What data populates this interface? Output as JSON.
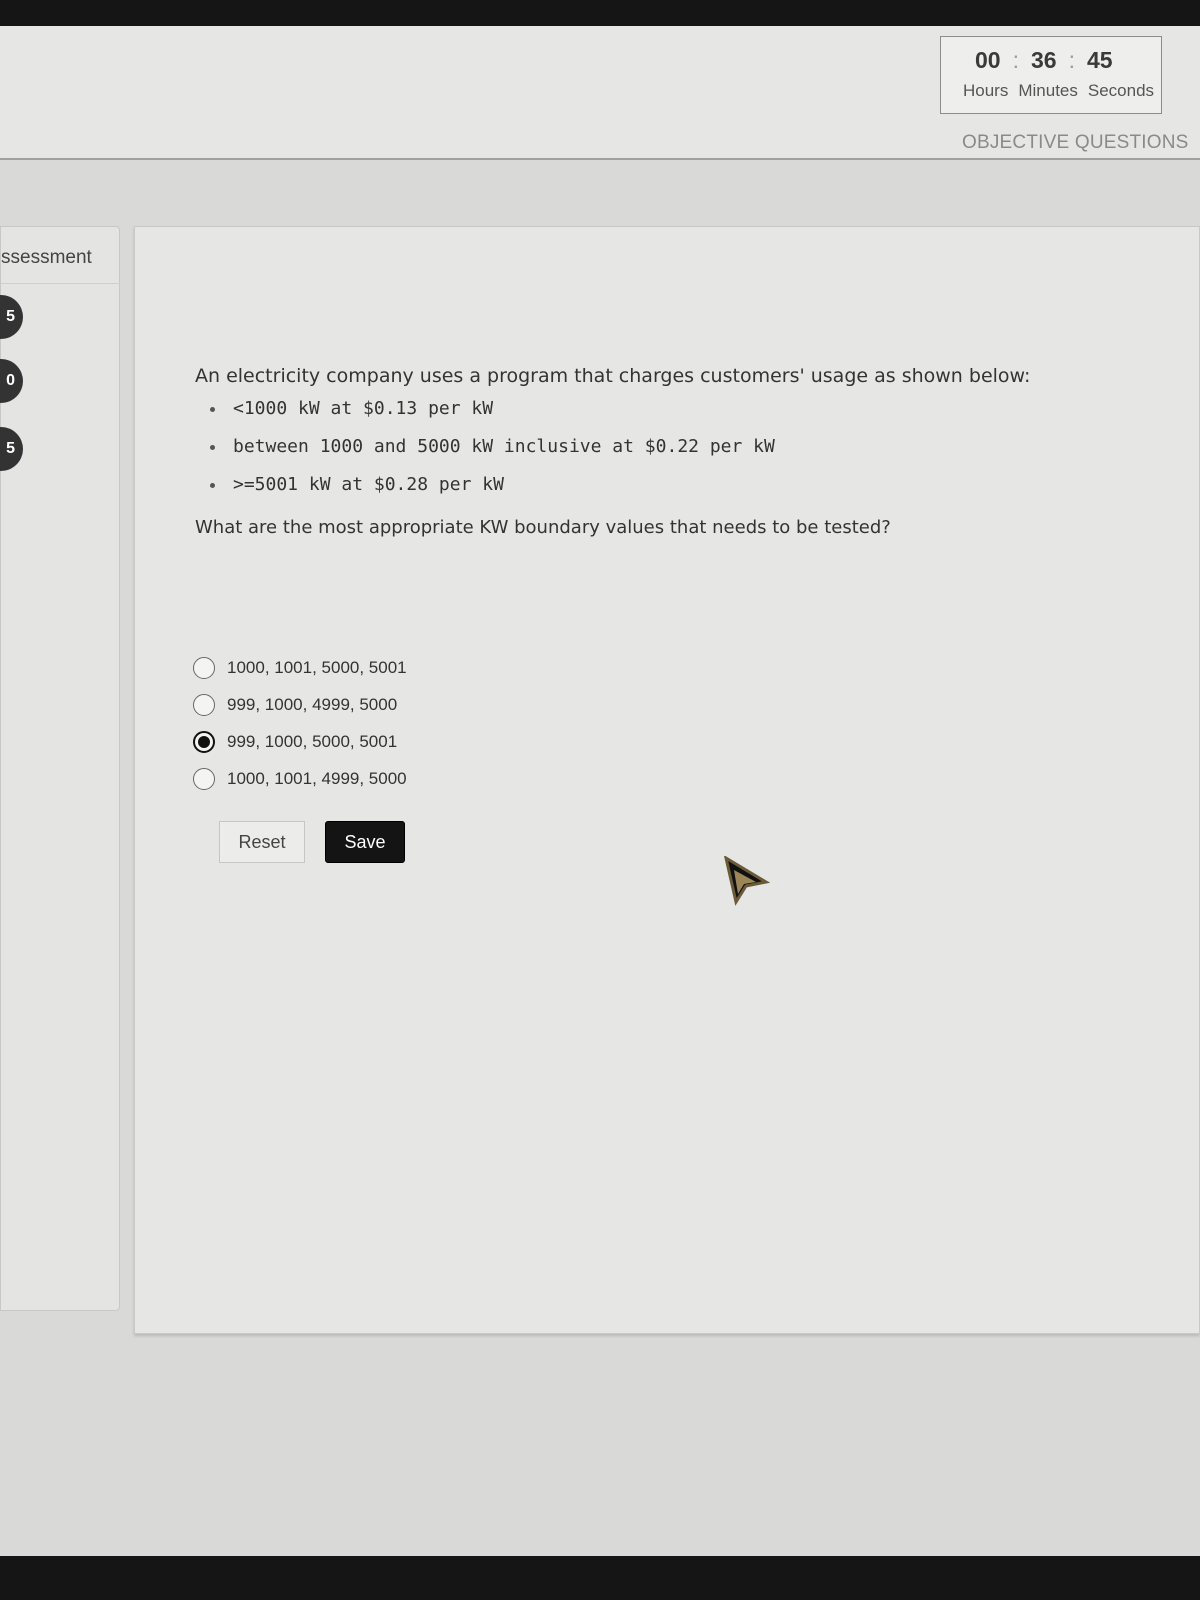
{
  "timer": {
    "hours": "00",
    "minutes": "36",
    "seconds": "45",
    "separator": ":",
    "hours_label": "Hours",
    "minutes_label": "Minutes",
    "seconds_label": "Seconds"
  },
  "header": {
    "section_tab": "OBJECTIVE QUESTIONS"
  },
  "sidebar": {
    "title": "ssessment",
    "question_numbers": [
      "5",
      "0",
      "5"
    ]
  },
  "question": {
    "intro": "An electricity company  uses a program that charges customers' usage as shown below:",
    "rules": [
      "<1000 kW at $0.13 per kW",
      "between 1000 and 5000 kW inclusive at $0.22 per kW",
      ">=5001 kW at $0.28 per kW"
    ],
    "prompt": "What are the most appropriate KW boundary values that needs to be tested?"
  },
  "options": [
    {
      "label": "1000, 1001, 5000, 5001",
      "selected": false
    },
    {
      "label": "999, 1000, 4999, 5000",
      "selected": false
    },
    {
      "label": "999, 1000, 5000, 5001",
      "selected": true
    },
    {
      "label": "1000, 1001, 4999, 5000",
      "selected": false
    }
  ],
  "buttons": {
    "reset_label": "Reset",
    "save_label": "Save"
  },
  "icons": {
    "cursor": "pointer-arrow-icon"
  }
}
